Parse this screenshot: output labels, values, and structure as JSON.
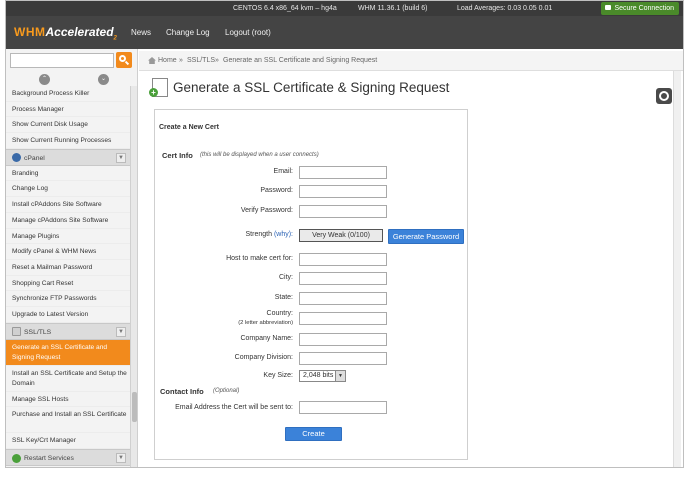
{
  "status_bar": {
    "os": "CENTOS 6.4 x86_64 kvm – hg4a",
    "whm": "WHM 11.36.1 (build 6)",
    "load": "Load Averages: 0.03 0.05 0.01",
    "secure": "Secure Connection"
  },
  "nav": {
    "logo_whm": "WHM",
    "logo_rest": "Accelerated",
    "logo_sub": "2",
    "links": [
      "News",
      "Change Log",
      "Logout (root)"
    ]
  },
  "sidebar": {
    "search_placeholder": "",
    "collapse_up": "⌃",
    "collapse_down": "⌄",
    "items_top": [
      "Background Process Killer",
      "Process Manager",
      "Show Current Disk Usage",
      "Show Current Running Processes"
    ],
    "cat_cpanel": "cPanel",
    "items_cpanel": [
      "Branding",
      "Change Log",
      "Install cPAddons Site Software",
      "Manage cPAddons Site Software",
      "Manage Plugins",
      "Modify cPanel & WHM News",
      "Reset a Mailman Password",
      "Shopping Cart Reset",
      "Synchronize FTP Passwords",
      "Upgrade to Latest Version"
    ],
    "cat_ssl": "SSL/TLS",
    "items_ssl": [
      "Generate an SSL Certificate and Signing Request",
      "Install an SSL Certificate and Setup the Domain",
      "Manage SSL Hosts",
      "Purchase and Install an SSL Certificate",
      "SSL Key/Crt Manager"
    ],
    "cat_restart": "Restart Services"
  },
  "breadcrumb": {
    "home": "Home",
    "sep": "»",
    "section": "SSL/TLS",
    "page": "Generate an SSL Certificate and Signing Request"
  },
  "page_title": "Generate a SSL Certificate & Signing Request",
  "form": {
    "heading": "Create a New Cert",
    "cert_info": "Cert Info",
    "cert_info_note": "(this will be displayed when a user connects)",
    "email": "Email:",
    "password": "Password:",
    "verify": "Verify Password:",
    "strength": "Strength",
    "why": "(why):",
    "strength_value": "Very Weak (0/100)",
    "generate_password": "Generate Password",
    "host": "Host to make cert for:",
    "city": "City:",
    "state": "State:",
    "country": "Country:",
    "country_note": "(2 letter abbreviation)",
    "company": "Company Name:",
    "division": "Company Division:",
    "key_size": "Key Size:",
    "key_size_value": "2,048 bits",
    "contact_info": "Contact Info",
    "optional": "(Optional)",
    "contact_email": "Email Address the Cert will be sent to:",
    "create": "Create"
  }
}
